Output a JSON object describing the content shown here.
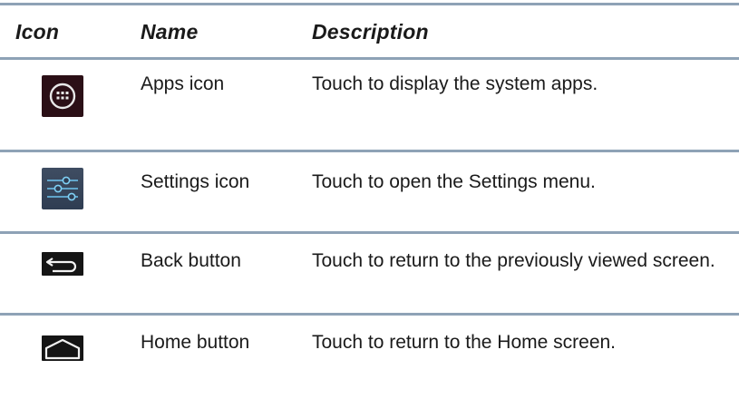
{
  "header": {
    "icon": "Icon",
    "name": "Name",
    "description": "Description"
  },
  "rows": [
    {
      "icon": "apps-icon",
      "name": "Apps icon",
      "description": "Touch to display the system apps."
    },
    {
      "icon": "settings-icon",
      "name": "Settings icon",
      "description": "Touch to open the Settings menu."
    },
    {
      "icon": "back-icon",
      "name": "Back button",
      "description": "Touch to return to the previously viewed screen."
    },
    {
      "icon": "home-icon",
      "name": "Home button",
      "description": "Touch to return to the Home screen."
    }
  ],
  "colors": {
    "rule": "#8ea2b6",
    "text": "#1a1a1a",
    "apps_bg": "#2b0f16",
    "settings_bg": "#3f4d62",
    "icon_glow": "#4fb3e8"
  }
}
